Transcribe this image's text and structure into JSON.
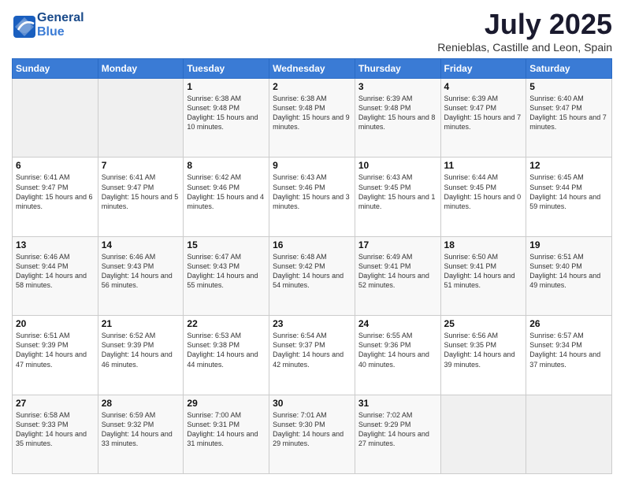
{
  "logo": {
    "line1": "General",
    "line2": "Blue"
  },
  "header": {
    "month": "July 2025",
    "location": "Renieblas, Castille and Leon, Spain"
  },
  "weekdays": [
    "Sunday",
    "Monday",
    "Tuesday",
    "Wednesday",
    "Thursday",
    "Friday",
    "Saturday"
  ],
  "weeks": [
    [
      {
        "day": "",
        "info": ""
      },
      {
        "day": "",
        "info": ""
      },
      {
        "day": "1",
        "info": "Sunrise: 6:38 AM\nSunset: 9:48 PM\nDaylight: 15 hours and 10 minutes."
      },
      {
        "day": "2",
        "info": "Sunrise: 6:38 AM\nSunset: 9:48 PM\nDaylight: 15 hours and 9 minutes."
      },
      {
        "day": "3",
        "info": "Sunrise: 6:39 AM\nSunset: 9:48 PM\nDaylight: 15 hours and 8 minutes."
      },
      {
        "day": "4",
        "info": "Sunrise: 6:39 AM\nSunset: 9:47 PM\nDaylight: 15 hours and 7 minutes."
      },
      {
        "day": "5",
        "info": "Sunrise: 6:40 AM\nSunset: 9:47 PM\nDaylight: 15 hours and 7 minutes."
      }
    ],
    [
      {
        "day": "6",
        "info": "Sunrise: 6:41 AM\nSunset: 9:47 PM\nDaylight: 15 hours and 6 minutes."
      },
      {
        "day": "7",
        "info": "Sunrise: 6:41 AM\nSunset: 9:47 PM\nDaylight: 15 hours and 5 minutes."
      },
      {
        "day": "8",
        "info": "Sunrise: 6:42 AM\nSunset: 9:46 PM\nDaylight: 15 hours and 4 minutes."
      },
      {
        "day": "9",
        "info": "Sunrise: 6:43 AM\nSunset: 9:46 PM\nDaylight: 15 hours and 3 minutes."
      },
      {
        "day": "10",
        "info": "Sunrise: 6:43 AM\nSunset: 9:45 PM\nDaylight: 15 hours and 1 minute."
      },
      {
        "day": "11",
        "info": "Sunrise: 6:44 AM\nSunset: 9:45 PM\nDaylight: 15 hours and 0 minutes."
      },
      {
        "day": "12",
        "info": "Sunrise: 6:45 AM\nSunset: 9:44 PM\nDaylight: 14 hours and 59 minutes."
      }
    ],
    [
      {
        "day": "13",
        "info": "Sunrise: 6:46 AM\nSunset: 9:44 PM\nDaylight: 14 hours and 58 minutes."
      },
      {
        "day": "14",
        "info": "Sunrise: 6:46 AM\nSunset: 9:43 PM\nDaylight: 14 hours and 56 minutes."
      },
      {
        "day": "15",
        "info": "Sunrise: 6:47 AM\nSunset: 9:43 PM\nDaylight: 14 hours and 55 minutes."
      },
      {
        "day": "16",
        "info": "Sunrise: 6:48 AM\nSunset: 9:42 PM\nDaylight: 14 hours and 54 minutes."
      },
      {
        "day": "17",
        "info": "Sunrise: 6:49 AM\nSunset: 9:41 PM\nDaylight: 14 hours and 52 minutes."
      },
      {
        "day": "18",
        "info": "Sunrise: 6:50 AM\nSunset: 9:41 PM\nDaylight: 14 hours and 51 minutes."
      },
      {
        "day": "19",
        "info": "Sunrise: 6:51 AM\nSunset: 9:40 PM\nDaylight: 14 hours and 49 minutes."
      }
    ],
    [
      {
        "day": "20",
        "info": "Sunrise: 6:51 AM\nSunset: 9:39 PM\nDaylight: 14 hours and 47 minutes."
      },
      {
        "day": "21",
        "info": "Sunrise: 6:52 AM\nSunset: 9:39 PM\nDaylight: 14 hours and 46 minutes."
      },
      {
        "day": "22",
        "info": "Sunrise: 6:53 AM\nSunset: 9:38 PM\nDaylight: 14 hours and 44 minutes."
      },
      {
        "day": "23",
        "info": "Sunrise: 6:54 AM\nSunset: 9:37 PM\nDaylight: 14 hours and 42 minutes."
      },
      {
        "day": "24",
        "info": "Sunrise: 6:55 AM\nSunset: 9:36 PM\nDaylight: 14 hours and 40 minutes."
      },
      {
        "day": "25",
        "info": "Sunrise: 6:56 AM\nSunset: 9:35 PM\nDaylight: 14 hours and 39 minutes."
      },
      {
        "day": "26",
        "info": "Sunrise: 6:57 AM\nSunset: 9:34 PM\nDaylight: 14 hours and 37 minutes."
      }
    ],
    [
      {
        "day": "27",
        "info": "Sunrise: 6:58 AM\nSunset: 9:33 PM\nDaylight: 14 hours and 35 minutes."
      },
      {
        "day": "28",
        "info": "Sunrise: 6:59 AM\nSunset: 9:32 PM\nDaylight: 14 hours and 33 minutes."
      },
      {
        "day": "29",
        "info": "Sunrise: 7:00 AM\nSunset: 9:31 PM\nDaylight: 14 hours and 31 minutes."
      },
      {
        "day": "30",
        "info": "Sunrise: 7:01 AM\nSunset: 9:30 PM\nDaylight: 14 hours and 29 minutes."
      },
      {
        "day": "31",
        "info": "Sunrise: 7:02 AM\nSunset: 9:29 PM\nDaylight: 14 hours and 27 minutes."
      },
      {
        "day": "",
        "info": ""
      },
      {
        "day": "",
        "info": ""
      }
    ]
  ]
}
